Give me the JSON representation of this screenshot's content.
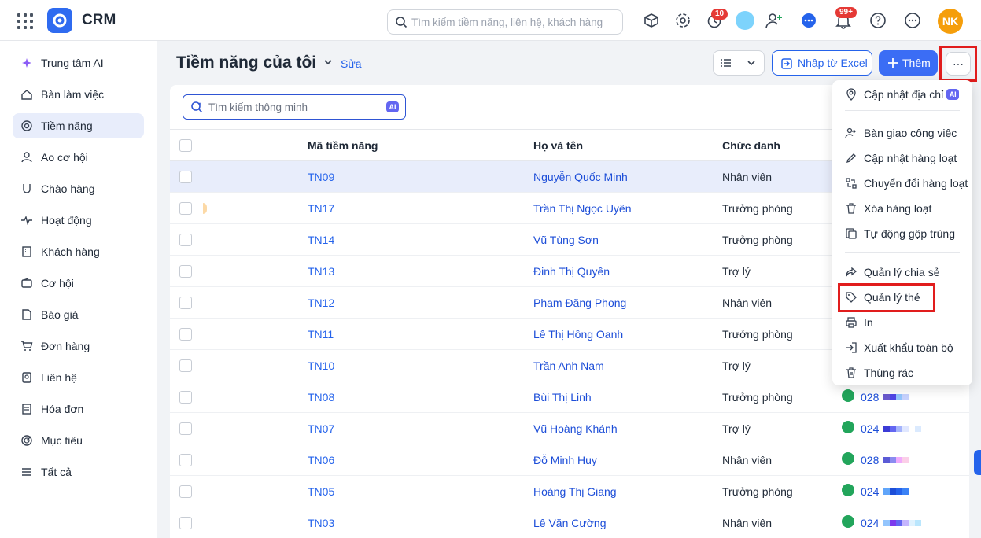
{
  "app": {
    "brand": "CRM"
  },
  "header": {
    "search_placeholder": "Tìm kiếm tiềm năng, liên hệ, khách hàng",
    "timer_badge": "10",
    "notification_badge": "99+",
    "avatar_initials": "NK"
  },
  "sidebar": {
    "items": [
      {
        "label": "Trung tâm AI",
        "icon": "sparkle-icon"
      },
      {
        "label": "Bàn làm việc",
        "icon": "home-icon"
      },
      {
        "label": "Tiềm năng",
        "icon": "target-icon"
      },
      {
        "label": "Ao cơ hội",
        "icon": "pool-icon"
      },
      {
        "label": "Chào hàng",
        "icon": "magnet-icon"
      },
      {
        "label": "Hoạt động",
        "icon": "activity-icon"
      },
      {
        "label": "Khách hàng",
        "icon": "building-icon"
      },
      {
        "label": "Cơ hội",
        "icon": "wallet-icon"
      },
      {
        "label": "Báo giá",
        "icon": "quote-icon"
      },
      {
        "label": "Đơn hàng",
        "icon": "cart-icon"
      },
      {
        "label": "Liên hệ",
        "icon": "contact-icon"
      },
      {
        "label": "Hóa đơn",
        "icon": "invoice-icon"
      },
      {
        "label": "Mục tiêu",
        "icon": "goal-icon"
      },
      {
        "label": "Tất cả",
        "icon": "menu-icon"
      }
    ]
  },
  "main": {
    "title": "Tiềm năng của tôi",
    "edit_label": "Sửa",
    "import_label": "Nhập từ Excel",
    "add_label": "Thêm",
    "more_label": "···",
    "smart_search_placeholder": "Tìm kiếm thông minh",
    "ai_label": "AI",
    "columns": {
      "code": "Mã tiềm năng",
      "name": "Họ và tên",
      "title": "Chức danh"
    },
    "rows": [
      {
        "code": "TN09",
        "name": "Nguyễn Quốc Minh",
        "title": "Nhân viên",
        "phone": ""
      },
      {
        "code": "TN17",
        "name": "Trần Thị Ngọc Uyên",
        "title": "Trưởng phòng",
        "phone": ""
      },
      {
        "code": "TN14",
        "name": "Vũ Tùng Sơn",
        "title": "Trưởng phòng",
        "phone": ""
      },
      {
        "code": "TN13",
        "name": "Đinh Thị Quyên",
        "title": "Trợ lý",
        "phone": ""
      },
      {
        "code": "TN12",
        "name": "Phạm Đăng Phong",
        "title": "Nhân viên",
        "phone": ""
      },
      {
        "code": "TN11",
        "name": "Lê Thị Hồng Oanh",
        "title": "Trưởng phòng",
        "phone": ""
      },
      {
        "code": "TN10",
        "name": "Trần Anh Nam",
        "title": "Trợ lý",
        "phone": ""
      },
      {
        "code": "TN08",
        "name": "Bùi Thị Linh",
        "title": "Trưởng phòng",
        "phone": "028"
      },
      {
        "code": "TN07",
        "name": "Vũ Hoàng Khánh",
        "title": "Trợ lý",
        "phone": "024"
      },
      {
        "code": "TN06",
        "name": "Đỗ Minh Huy",
        "title": "Nhân viên",
        "phone": "028"
      },
      {
        "code": "TN05",
        "name": "Hoàng Thị Giang",
        "title": "Trưởng phòng",
        "phone": "024"
      },
      {
        "code": "TN03",
        "name": "Lê Văn Cường",
        "title": "Nhân viên",
        "phone": "024"
      }
    ]
  },
  "menu": {
    "items": [
      {
        "label": "Cập nhật địa chỉ",
        "icon": "map-pin-icon",
        "ai": "AI"
      },
      {
        "label": "Bàn giao công việc",
        "icon": "users-handover-icon"
      },
      {
        "label": "Cập nhật hàng loạt",
        "icon": "pencil-icon"
      },
      {
        "label": "Chuyển đổi hàng loạt",
        "icon": "convert-icon"
      },
      {
        "label": "Xóa hàng loạt",
        "icon": "trash-icon"
      },
      {
        "label": "Tự động gộp trùng",
        "icon": "merge-icon"
      },
      {
        "label": "Quản lý chia sẻ",
        "icon": "share-icon"
      },
      {
        "label": "Quản lý thẻ",
        "icon": "tag-icon"
      },
      {
        "label": "In",
        "icon": "printer-icon"
      },
      {
        "label": "Xuất khẩu toàn bộ",
        "icon": "export-icon"
      },
      {
        "label": "Thùng rác",
        "icon": "bin-icon"
      }
    ]
  },
  "colors": {
    "accent": "#3b6df5",
    "highlight": "#e11d1d",
    "selected_row": "#e8edfb"
  }
}
